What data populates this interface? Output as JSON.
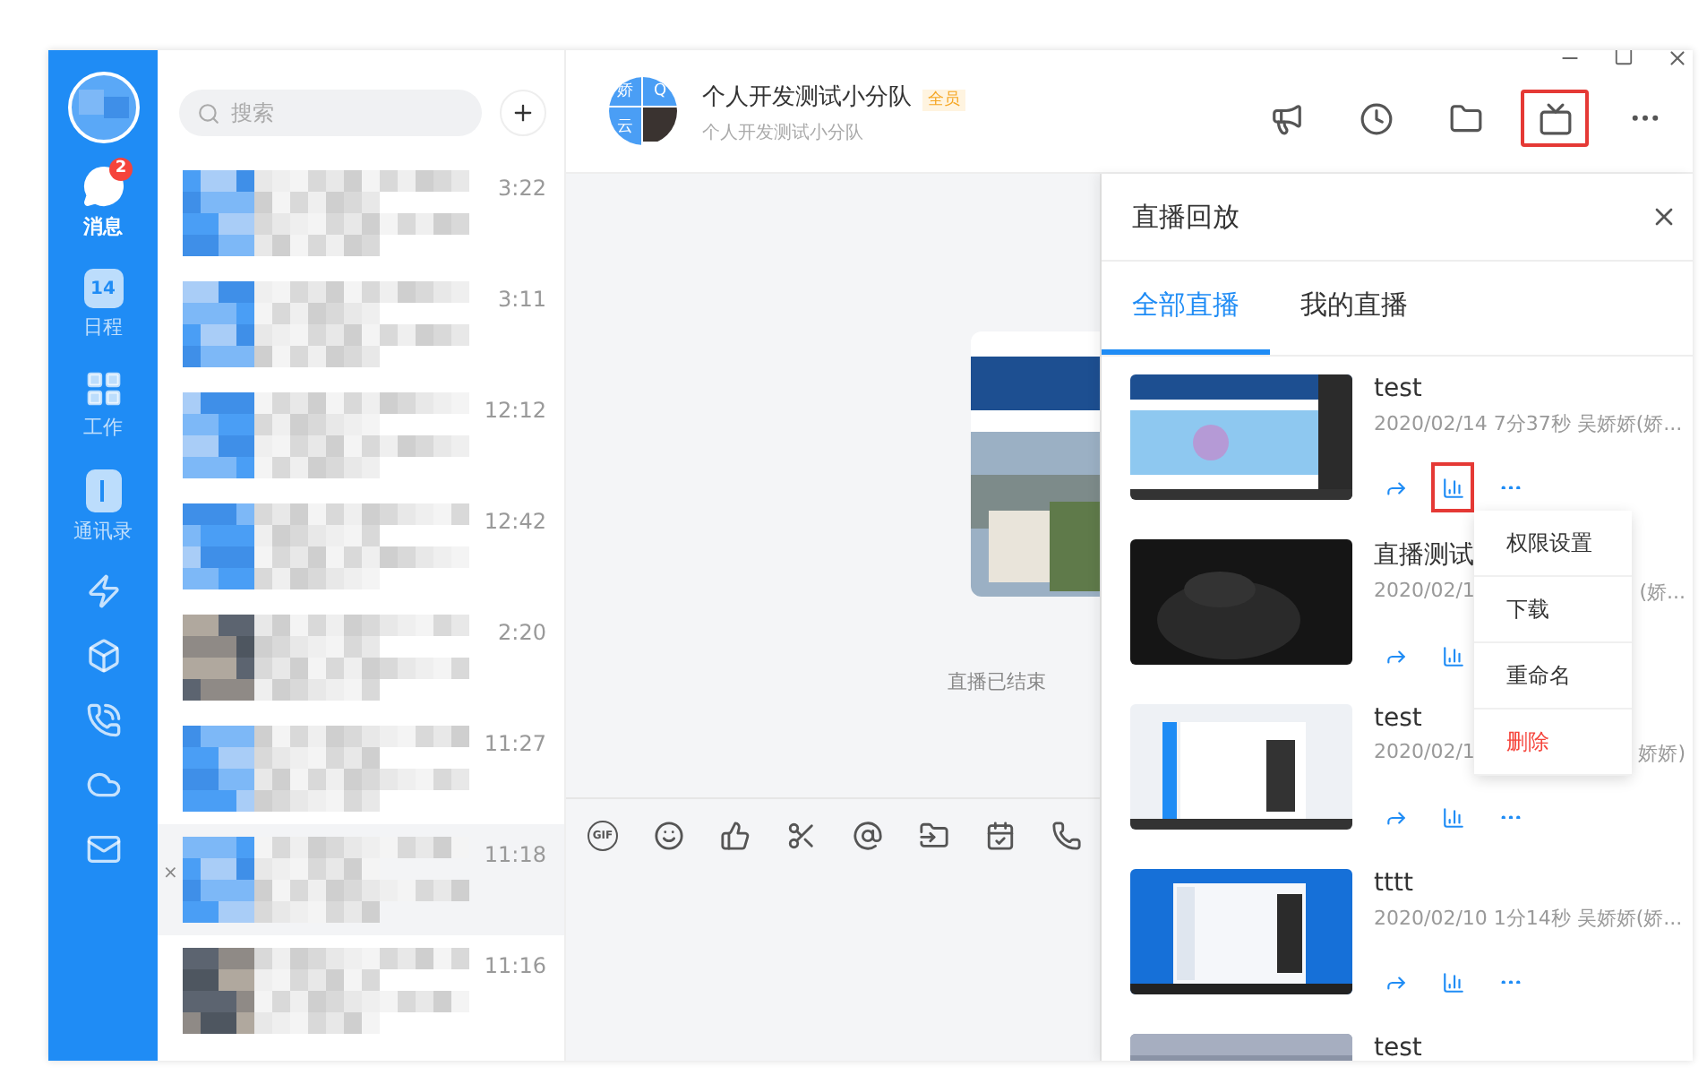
{
  "nav": {
    "items": [
      {
        "kind": "chat",
        "label": "消息",
        "badge": "2",
        "selected": true
      },
      {
        "kind": "calendar",
        "label": "日程",
        "day": "14",
        "selected": false
      },
      {
        "kind": "apps",
        "label": "工作",
        "selected": false
      },
      {
        "kind": "contacts",
        "label": "通讯录",
        "selected": false
      },
      {
        "kind": "bolt",
        "selected": false
      },
      {
        "kind": "cube",
        "selected": false
      },
      {
        "kind": "phone",
        "selected": false
      },
      {
        "kind": "cloud",
        "selected": false
      },
      {
        "kind": "mail",
        "selected": false
      }
    ]
  },
  "conversations": {
    "search": {
      "placeholder": "搜索"
    },
    "rows": [
      {
        "time": "3:22",
        "selected": false
      },
      {
        "time": "3:11",
        "selected": false
      },
      {
        "time": "12:12",
        "selected": false
      },
      {
        "time": "12:42",
        "selected": false
      },
      {
        "time": "2:20",
        "selected": false
      },
      {
        "time": "11:27",
        "selected": false
      },
      {
        "time": "11:18",
        "selected": true,
        "close_mark": "×"
      },
      {
        "time": "11:16",
        "selected": false
      }
    ]
  },
  "chat_header": {
    "avatar_cells": [
      "娇",
      "Q",
      "云"
    ],
    "title": "个人开发测试小分队",
    "badge": "全员",
    "subtitle": "个人开发测试小分队",
    "tools": [
      {
        "kind": "megaphone",
        "highlighted": false
      },
      {
        "kind": "clock",
        "highlighted": false
      },
      {
        "kind": "folder",
        "highlighted": false
      },
      {
        "kind": "live",
        "highlighted": true
      },
      {
        "kind": "more",
        "highlighted": false
      }
    ]
  },
  "chat": {
    "status": "直播已结束"
  },
  "composer_tools": [
    {
      "kind": "gif",
      "label": "GIF"
    },
    {
      "kind": "smile"
    },
    {
      "kind": "like"
    },
    {
      "kind": "cut"
    },
    {
      "kind": "at"
    },
    {
      "kind": "file"
    },
    {
      "kind": "schedule"
    },
    {
      "kind": "call"
    }
  ],
  "replay_panel": {
    "title": "直播回放",
    "tabs": [
      {
        "label": "全部直播",
        "selected": true
      },
      {
        "label": "我的直播",
        "selected": false
      }
    ],
    "items": [
      {
        "title": "test",
        "meta": "2020/02/14 7分37秒 吴娇娇(娇...",
        "stats_highlighted": true
      },
      {
        "title": "直播测试",
        "meta": "2020/02/1",
        "meta_tail": "(娇...",
        "stats_highlighted": false
      },
      {
        "title": "test",
        "meta": "2020/02/1",
        "meta_tail": "娇娇)",
        "stats_highlighted": false
      },
      {
        "title": "tttt",
        "meta": "2020/02/10 1分14秒 吴娇娇(娇...",
        "stats_highlighted": false
      },
      {
        "title": "test"
      }
    ],
    "menu": [
      {
        "label": "权限设置",
        "danger": false
      },
      {
        "label": "下载",
        "danger": false
      },
      {
        "label": "重命名",
        "danger": false
      },
      {
        "label": "删除",
        "danger": true
      }
    ]
  }
}
